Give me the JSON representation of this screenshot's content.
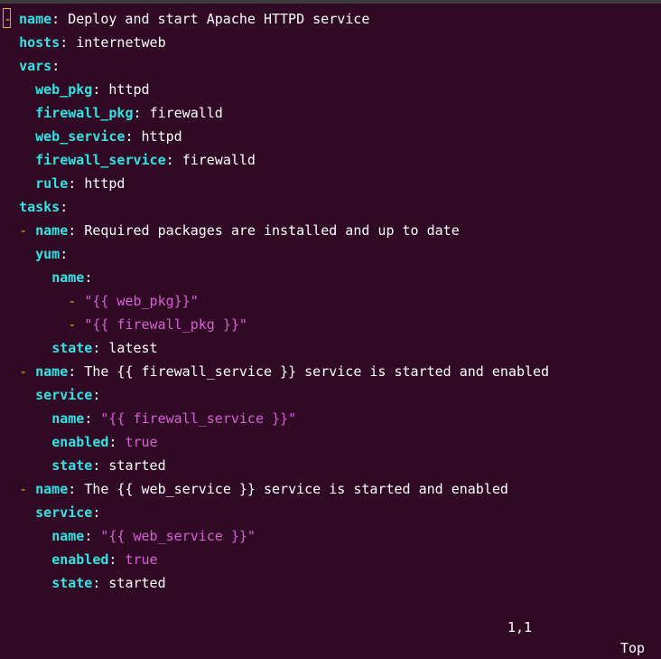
{
  "editor": {
    "lines": [
      {
        "indent": "",
        "dash": "-",
        "key": "name",
        "value": "Deploy and start Apache HTTPD service",
        "type": "plain",
        "cursor": true
      },
      {
        "indent": "  ",
        "dash": "",
        "key": "hosts",
        "value": "internetweb",
        "type": "plain"
      },
      {
        "indent": "  ",
        "dash": "",
        "key": "vars",
        "value": "",
        "type": "plain"
      },
      {
        "indent": "    ",
        "dash": "",
        "key": "web_pkg",
        "value": "httpd",
        "type": "plain"
      },
      {
        "indent": "    ",
        "dash": "",
        "key": "firewall_pkg",
        "value": "firewalld",
        "type": "plain"
      },
      {
        "indent": "    ",
        "dash": "",
        "key": "web_service",
        "value": "httpd",
        "type": "plain"
      },
      {
        "indent": "    ",
        "dash": "",
        "key": "firewall_service",
        "value": "firewalld",
        "type": "plain"
      },
      {
        "indent": "    ",
        "dash": "",
        "key": "rule",
        "value": "httpd",
        "type": "plain"
      },
      {
        "indent": "  ",
        "dash": "",
        "key": "tasks",
        "value": "",
        "type": "plain"
      },
      {
        "indent": "  ",
        "dash": "-",
        "key": "name",
        "value": "Required packages are installed and up to date",
        "type": "plain"
      },
      {
        "indent": "    ",
        "dash": "",
        "key": "yum",
        "value": "",
        "type": "plain"
      },
      {
        "indent": "      ",
        "dash": "",
        "key": "name",
        "value": "",
        "type": "plain"
      },
      {
        "indent": "        ",
        "dash": "-",
        "key": "",
        "value": "\"{{ web_pkg}}\"",
        "type": "str"
      },
      {
        "indent": "        ",
        "dash": "-",
        "key": "",
        "value": "\"{{ firewall_pkg }}\"",
        "type": "str"
      },
      {
        "indent": "      ",
        "dash": "",
        "key": "state",
        "value": "latest",
        "type": "plain"
      },
      {
        "indent": "  ",
        "dash": "-",
        "key": "name",
        "value": "The {{ firewall_service }} service is started and enabled",
        "type": "plain"
      },
      {
        "indent": "    ",
        "dash": "",
        "key": "service",
        "value": "",
        "type": "plain"
      },
      {
        "indent": "      ",
        "dash": "",
        "key": "name",
        "value": "\"{{ firewall_service }}\"",
        "type": "str"
      },
      {
        "indent": "      ",
        "dash": "",
        "key": "enabled",
        "value": "true",
        "type": "bool"
      },
      {
        "indent": "      ",
        "dash": "",
        "key": "state",
        "value": "started",
        "type": "plain"
      },
      {
        "indent": "  ",
        "dash": "-",
        "key": "name",
        "value": "The {{ web_service }} service is started and enabled",
        "type": "plain"
      },
      {
        "indent": "    ",
        "dash": "",
        "key": "service",
        "value": "",
        "type": "plain"
      },
      {
        "indent": "      ",
        "dash": "",
        "key": "name",
        "value": "\"{{ web_service }}\"",
        "type": "str"
      },
      {
        "indent": "      ",
        "dash": "",
        "key": "enabled",
        "value": "true",
        "type": "bool"
      },
      {
        "indent": "      ",
        "dash": "",
        "key": "state",
        "value": "started",
        "type": "plain"
      }
    ]
  },
  "status": {
    "position": "1,1",
    "scroll": "Top"
  },
  "colors": {
    "background": "#300a24",
    "key": "#34e2e2",
    "dash": "#e9ad0c",
    "string": "#d75fd7",
    "text": "#ffffff"
  }
}
